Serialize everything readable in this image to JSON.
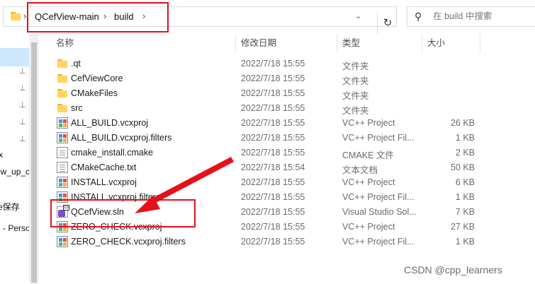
{
  "address": {
    "breadcrumbs": [
      "QCefView-main",
      "build"
    ],
    "chevron": "›",
    "dropdown_icon": "chevron-down-icon",
    "refresh_icon": "refresh-icon",
    "refresh_glyph": "↻"
  },
  "search": {
    "placeholder": "在 build 中搜索",
    "icon_glyph": "⚲"
  },
  "nav": {
    "text_items": [
      "x",
      "ew_up_c",
      "e保存",
      "- Perso"
    ],
    "pin_glyph": "📌"
  },
  "columns": {
    "name": "名称",
    "date": "修改日期",
    "type": "类型",
    "size": "大小"
  },
  "files": [
    {
      "name": ".qt",
      "date": "2022/7/18 15:55",
      "type": "文件夹",
      "size": "",
      "icon": "folder-icon"
    },
    {
      "name": "CefViewCore",
      "date": "2022/7/18 15:55",
      "type": "文件夹",
      "size": "",
      "icon": "folder-icon"
    },
    {
      "name": "CMakeFiles",
      "date": "2022/7/18 15:55",
      "type": "文件夹",
      "size": "",
      "icon": "folder-icon"
    },
    {
      "name": "src",
      "date": "2022/7/18 15:55",
      "type": "文件夹",
      "size": "",
      "icon": "folder-icon"
    },
    {
      "name": "ALL_BUILD.vcxproj",
      "date": "2022/7/18 15:55",
      "type": "VC++ Project",
      "size": "26 KB",
      "icon": "vcxproj-icon"
    },
    {
      "name": "ALL_BUILD.vcxproj.filters",
      "date": "2022/7/18 15:55",
      "type": "VC++ Project Fil...",
      "size": "1 KB",
      "icon": "vcxproj-icon"
    },
    {
      "name": "cmake_install.cmake",
      "date": "2022/7/18 15:55",
      "type": "CMAKE 文件",
      "size": "2 KB",
      "icon": "document-icon"
    },
    {
      "name": "CMakeCache.txt",
      "date": "2022/7/18 15:54",
      "type": "文本文档",
      "size": "50 KB",
      "icon": "text-file-icon"
    },
    {
      "name": "INSTALL.vcxproj",
      "date": "2022/7/18 15:55",
      "type": "VC++ Project",
      "size": "6 KB",
      "icon": "vcxproj-icon"
    },
    {
      "name": "INSTALL.vcxproj.filters",
      "date": "2022/7/18 15:55",
      "type": "VC++ Project Fil...",
      "size": "1 KB",
      "icon": "vcxproj-icon"
    },
    {
      "name": "QCefView.sln",
      "date": "2022/7/18 15:55",
      "type": "Visual Studio Sol...",
      "size": "7 KB",
      "icon": "visual-studio-solution-icon"
    },
    {
      "name": "ZERO_CHECK.vcxproj",
      "date": "2022/7/18 15:55",
      "type": "VC++ Project",
      "size": "27 KB",
      "icon": "vcxproj-icon"
    },
    {
      "name": "ZERO_CHECK.vcxproj.filters",
      "date": "2022/7/18 15:55",
      "type": "VC++ Project Fil...",
      "size": "1 KB",
      "icon": "vcxproj-icon"
    }
  ],
  "watermark": "CSDN @cpp_learners",
  "colors": {
    "annotation_red": "#e6101b",
    "selection_blue": "#cce8ff",
    "folder_yellow": "#ffd561"
  }
}
